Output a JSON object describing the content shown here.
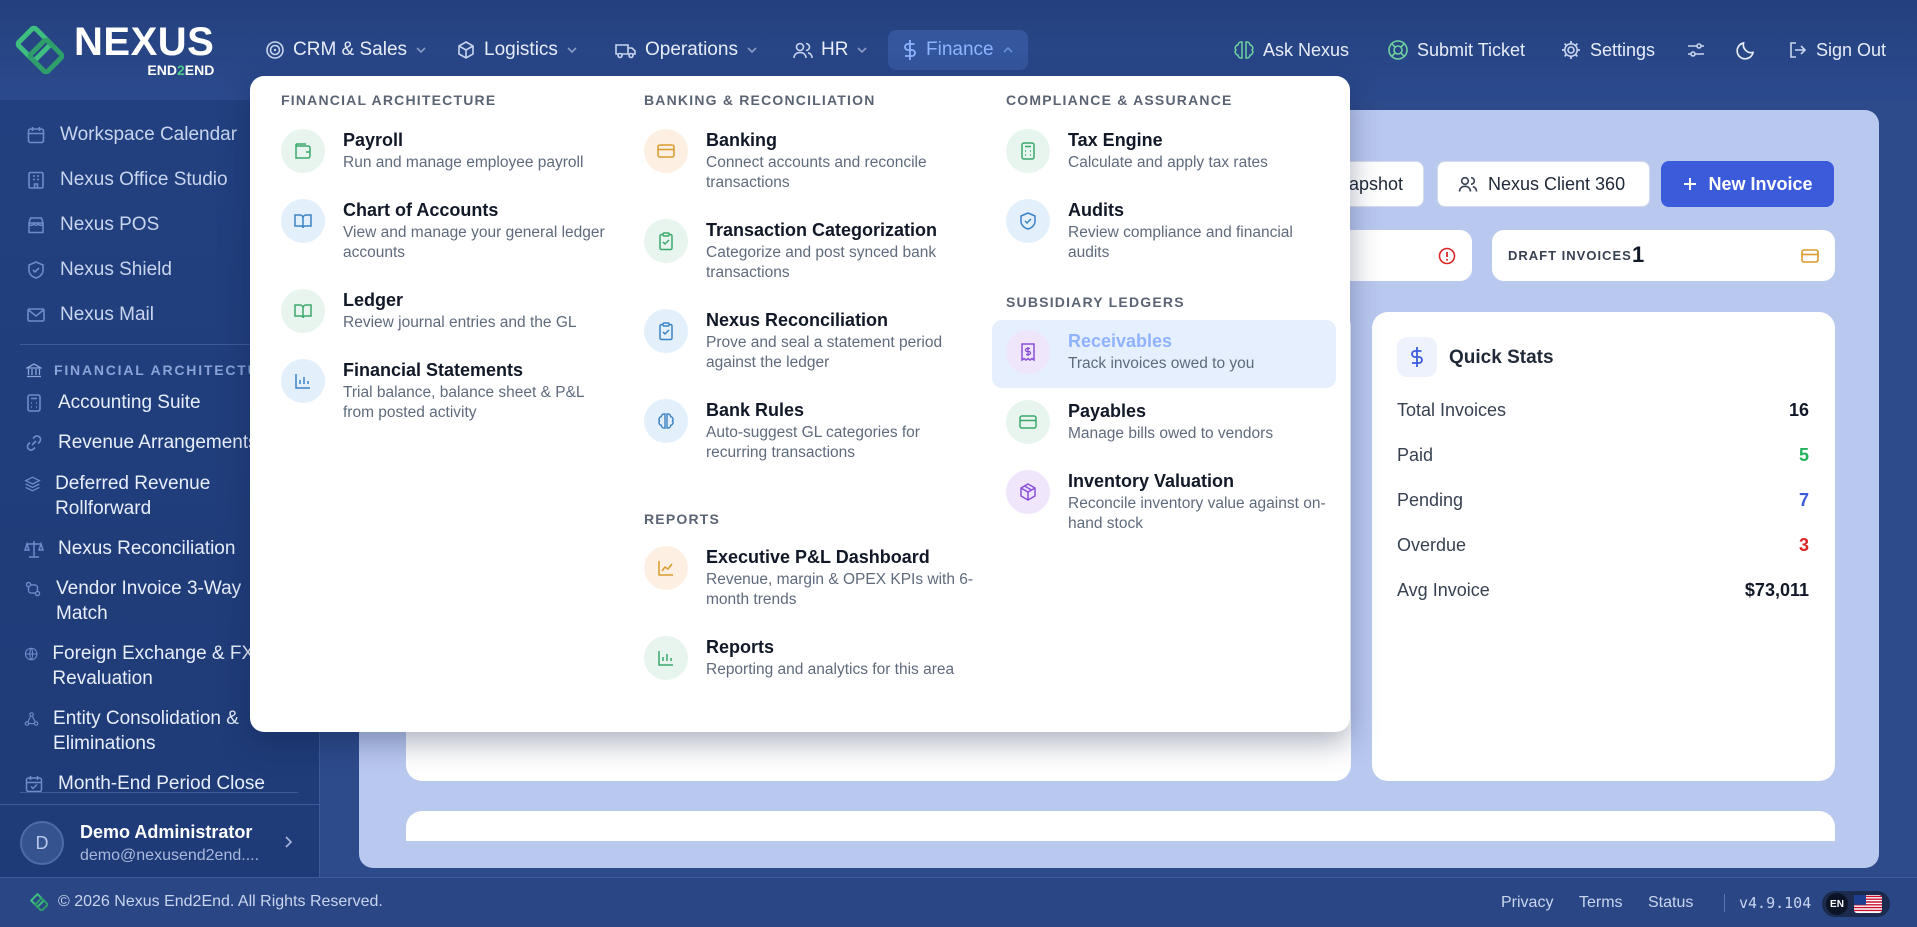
{
  "brand": {
    "name": "NEXUS",
    "sub_prefix": "END",
    "sub_mid": "2",
    "sub_suffix": "END"
  },
  "nav": {
    "items": [
      {
        "label": "CRM & Sales",
        "icon": "target-icon"
      },
      {
        "label": "Logistics",
        "icon": "box-icon"
      },
      {
        "label": "Operations",
        "icon": "truck-icon"
      },
      {
        "label": "HR",
        "icon": "users-icon"
      },
      {
        "label": "Finance",
        "icon": "dollar-icon",
        "active": true
      }
    ],
    "right": {
      "ask": "Ask Nexus",
      "ticket": "Submit Ticket",
      "settings": "Settings",
      "signout": "Sign Out"
    }
  },
  "sidebar": {
    "workspace_items": [
      {
        "label": "Workspace Calendar",
        "icon": "calendar-icon"
      },
      {
        "label": "Nexus Office Studio",
        "icon": "building-icon"
      },
      {
        "label": "Nexus POS",
        "icon": "store-icon"
      },
      {
        "label": "Nexus Shield",
        "icon": "shield-icon"
      },
      {
        "label": "Nexus Mail",
        "icon": "mail-icon"
      }
    ],
    "section_heading": "FINANCIAL ARCHITECTUR",
    "finance_items": [
      {
        "label": "Accounting Suite"
      },
      {
        "label": "Revenue Arrangements"
      },
      {
        "label": "Deferred Revenue Rollforward"
      },
      {
        "label": "Nexus Reconciliation"
      },
      {
        "label": "Vendor Invoice 3-Way Match"
      },
      {
        "label": "Foreign Exchange & FX Revaluation"
      },
      {
        "label": "Entity Consolidation & Eliminations"
      },
      {
        "label": "Month-End Period Close"
      }
    ],
    "user": {
      "initial": "D",
      "name": "Demo Administrator",
      "email": "demo@nexusend2end...."
    }
  },
  "toolbar": {
    "snapshot_label": "apshot",
    "client360_label": "Nexus Client 360",
    "new_invoice_label": "New Invoice"
  },
  "stats": {
    "draft_label": "DRAFT INVOICES",
    "draft_value": "1"
  },
  "quick_stats": {
    "title": "Quick Stats",
    "rows": [
      {
        "label": "Total Invoices",
        "value": "16",
        "color": "#111827"
      },
      {
        "label": "Paid",
        "value": "5",
        "color": "#22b35a"
      },
      {
        "label": "Pending",
        "value": "7",
        "color": "#3b5bdb"
      },
      {
        "label": "Overdue",
        "value": "3",
        "color": "#dc2626"
      },
      {
        "label": "Avg Invoice",
        "value": "$73,011",
        "color": "#111827"
      }
    ]
  },
  "menu": {
    "col1": {
      "heading": "FINANCIAL ARCHITECTURE",
      "items": [
        {
          "title": "Payroll",
          "desc": "Run and manage employee payroll",
          "icon": "wallet-icon"
        },
        {
          "title": "Chart of Accounts",
          "desc": "View and manage your general ledger accounts",
          "icon": "book-open-icon"
        },
        {
          "title": "Ledger",
          "desc": "Review journal entries and the GL",
          "icon": "book-icon"
        },
        {
          "title": "Financial Statements",
          "desc": "Trial balance, balance sheet & P&L from posted activity",
          "icon": "bar-chart-icon"
        }
      ]
    },
    "col2": {
      "heading": "BANKING & RECONCILIATION",
      "items": [
        {
          "title": "Banking",
          "desc": "Connect accounts and reconcile transactions",
          "icon": "credit-card-icon"
        },
        {
          "title": "Transaction Categorization",
          "desc": "Categorize and post synced bank transactions",
          "icon": "clipboard-check-icon"
        },
        {
          "title": "Nexus Reconciliation",
          "desc": "Prove and seal a statement period against the ledger",
          "icon": "clipboard-check-icon"
        },
        {
          "title": "Bank Rules",
          "desc": "Auto-suggest GL categories for recurring transactions",
          "icon": "brain-icon"
        }
      ],
      "reports_heading": "REPORTS",
      "reports": [
        {
          "title": "Executive P&L Dashboard",
          "desc": "Revenue, margin & OPEX KPIs with 6-month trends",
          "icon": "trend-chart-icon"
        },
        {
          "title": "Reports",
          "desc": "Reporting and analytics for this area",
          "icon": "bar-chart-icon"
        }
      ]
    },
    "col3": {
      "heading": "COMPLIANCE & ASSURANCE",
      "items": [
        {
          "title": "Tax Engine",
          "desc": "Calculate and apply tax rates",
          "icon": "calculator-icon"
        },
        {
          "title": "Audits",
          "desc": "Review compliance and financial audits",
          "icon": "shield-check-icon"
        }
      ],
      "sub_heading": "SUBSIDIARY LEDGERS",
      "sub_items": [
        {
          "title": "Receivables",
          "desc": "Track invoices owed to you",
          "icon": "receipt-icon",
          "highlight": true
        },
        {
          "title": "Payables",
          "desc": "Manage bills owed to vendors",
          "icon": "credit-card-icon"
        },
        {
          "title": "Inventory Valuation",
          "desc": "Reconcile inventory value against on-hand stock",
          "icon": "package-icon"
        }
      ]
    }
  },
  "footer": {
    "copyright": "© 2026 Nexus End2End. All Rights Reserved.",
    "privacy": "Privacy",
    "terms": "Terms",
    "status": "Status",
    "version": "v4.9.104",
    "lang": "EN"
  }
}
